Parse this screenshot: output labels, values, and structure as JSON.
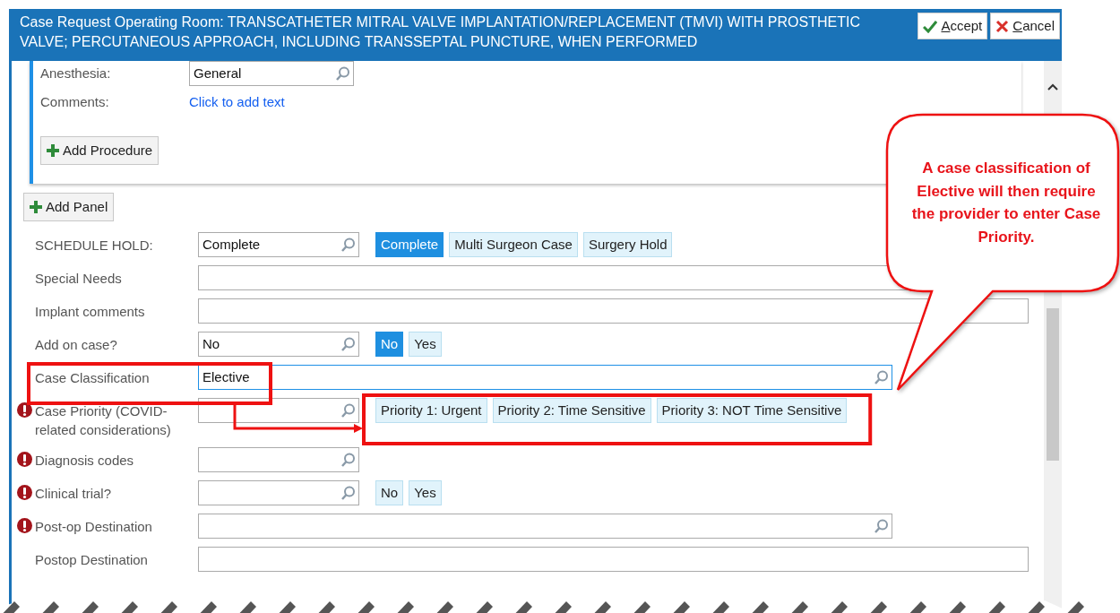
{
  "window": {
    "title": "Case Request Operating Room: TRANSCATHETER MITRAL VALVE IMPLANTATION/REPLACEMENT (TMVI) WITH PROSTHETIC VALVE; PERCUTANEOUS APPROACH, INCLUDING TRANSSEPTAL PUNCTURE, WHEN PERFORMED"
  },
  "header_buttons": [
    {
      "label": "Accept",
      "kind": "accept"
    },
    {
      "label": "Cancel",
      "kind": "cancel"
    }
  ],
  "procedure_panel": {
    "rows": [
      {
        "label": "Anesthesia:",
        "kind": "lookup",
        "value": "General"
      },
      {
        "label": "Comments:",
        "kind": "link",
        "value": "Click to add text"
      }
    ],
    "add_button": "Add Procedure"
  },
  "add_panel_button": "Add Panel",
  "form": [
    {
      "label": "SCHEDULE HOLD:",
      "required": false,
      "field": {
        "kind": "lookup",
        "wide": false,
        "value": "Complete",
        "focused": false
      },
      "options": [
        {
          "label": "Complete",
          "selected": true
        },
        {
          "label": "Multi Surgeon Case",
          "selected": false
        },
        {
          "label": "Surgery Hold",
          "selected": false
        }
      ]
    },
    {
      "label": "Special Needs",
      "required": false,
      "field": {
        "kind": "text",
        "focused": false
      }
    },
    {
      "label": "Implant comments",
      "required": false,
      "field": {
        "kind": "text",
        "focused": false
      }
    },
    {
      "label": "Add on case?",
      "required": false,
      "field": {
        "kind": "lookup",
        "wide": false,
        "value": "No",
        "focused": false
      },
      "options": [
        {
          "label": "No",
          "selected": true
        },
        {
          "label": "Yes",
          "selected": false
        }
      ]
    },
    {
      "label": "Case Classification",
      "required": false,
      "annotated": true,
      "field": {
        "kind": "lookup",
        "wide": true,
        "value": "Elective",
        "focused": true
      }
    },
    {
      "label": "Case Priority (COVID-related considerations)",
      "required": true,
      "options_annotated": true,
      "field": {
        "kind": "lookup",
        "wide": false,
        "focused": false
      },
      "options": [
        {
          "label": "Priority 1: Urgent",
          "selected": false
        },
        {
          "label": "Priority 2: Time Sensitive",
          "selected": false
        },
        {
          "label": "Priority 3: NOT Time Sensitive",
          "selected": false
        }
      ]
    },
    {
      "label": "Diagnosis codes",
      "required": true,
      "field": {
        "kind": "lookup",
        "wide": false,
        "focused": false
      }
    },
    {
      "label": "Clinical trial?",
      "required": true,
      "field": {
        "kind": "lookup",
        "wide": false,
        "focused": false
      },
      "options": [
        {
          "label": "No",
          "selected": false
        },
        {
          "label": "Yes",
          "selected": false
        }
      ]
    },
    {
      "label": "Post-op Destination",
      "required": true,
      "field": {
        "kind": "lookup",
        "wide": true,
        "focused": false
      }
    },
    {
      "label": "Postop Destination",
      "required": false,
      "field": {
        "kind": "text",
        "focused": false
      }
    }
  ],
  "callout": {
    "text": "A case classification of Elective will then require the provider to enter Case Priority."
  }
}
